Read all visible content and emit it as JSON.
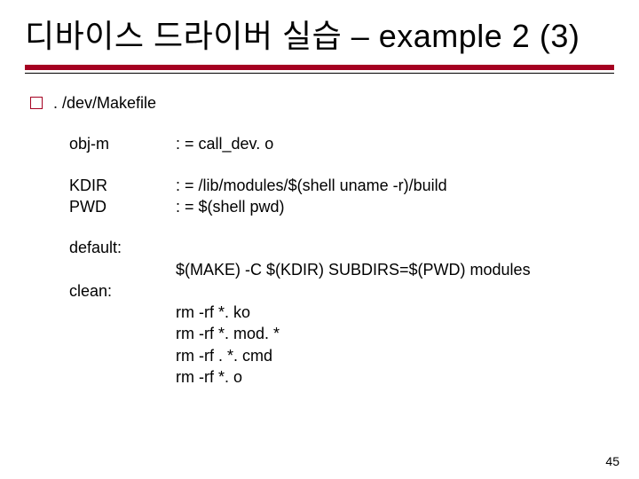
{
  "title": "디바이스 드라이버 실습 – example 2 (3)",
  "bullet": ". /dev/Makefile",
  "makefile": {
    "obj_m_lhs": "obj-m",
    "obj_m_rhs": ": = call_dev. o",
    "kdir_lhs": "KDIR",
    "kdir_rhs": ": = /lib/modules/$(shell uname -r)/build",
    "pwd_lhs": "PWD",
    "pwd_rhs": ": = $(shell pwd)",
    "default_label": "default:",
    "default_cmd": "$(MAKE) -C $(KDIR) SUBDIRS=$(PWD) modules",
    "clean_label": "clean:",
    "clean_cmds": [
      "rm -rf *. ko",
      "rm -rf *. mod. *",
      "rm -rf . *. cmd",
      "rm -rf *. o"
    ]
  },
  "page_number": "45"
}
